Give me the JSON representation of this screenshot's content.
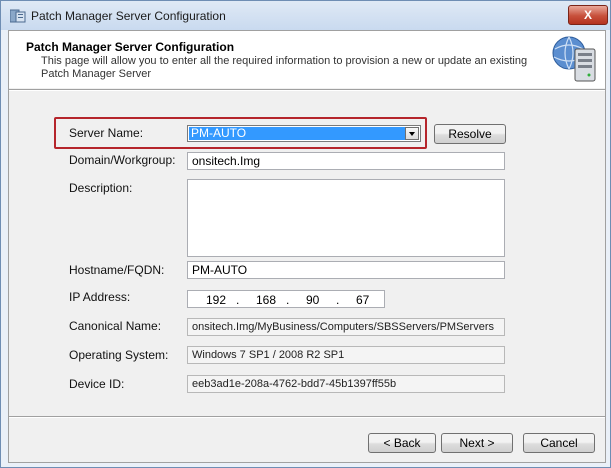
{
  "window": {
    "title": "Patch Manager Server Configuration",
    "close_glyph": "X"
  },
  "header": {
    "title": "Patch Manager Server Configuration",
    "description": "This page will allow you to enter all the required information to provision a new or update an existing Patch Manager Server"
  },
  "form": {
    "server_name_label": "Server Name:",
    "server_name_value": "PM-AUTO",
    "resolve_label": "Resolve",
    "domain_label": "Domain/Workgroup:",
    "domain_value": "onsitech.Img",
    "description_label": "Description:",
    "description_value": "",
    "hostname_label": "Hostname/FQDN:",
    "hostname_value": "PM-AUTO",
    "ip_label": "IP Address:",
    "ip_octets": [
      "192",
      "168",
      "90",
      "67"
    ],
    "ip_dot": ".",
    "canonical_label": "Canonical Name:",
    "canonical_value": "onsitech.Img/MyBusiness/Computers/SBSServers/PMServers",
    "os_label": "Operating System:",
    "os_value": "Windows 7 SP1 / 2008 R2 SP1",
    "device_label": "Device ID:",
    "device_value": "eeb3ad1e-208a-4762-bdd7-45b1397ff55b"
  },
  "footer": {
    "back_label": "< Back",
    "next_label": "Next >",
    "cancel_label": "Cancel"
  },
  "icons": {
    "app": "server-app-icon",
    "header": "server-globe-icon",
    "combo": "chevron-down-icon"
  },
  "colors": {
    "highlight": "#b5252b",
    "selection": "#3399ff",
    "close": "#c7503b"
  }
}
